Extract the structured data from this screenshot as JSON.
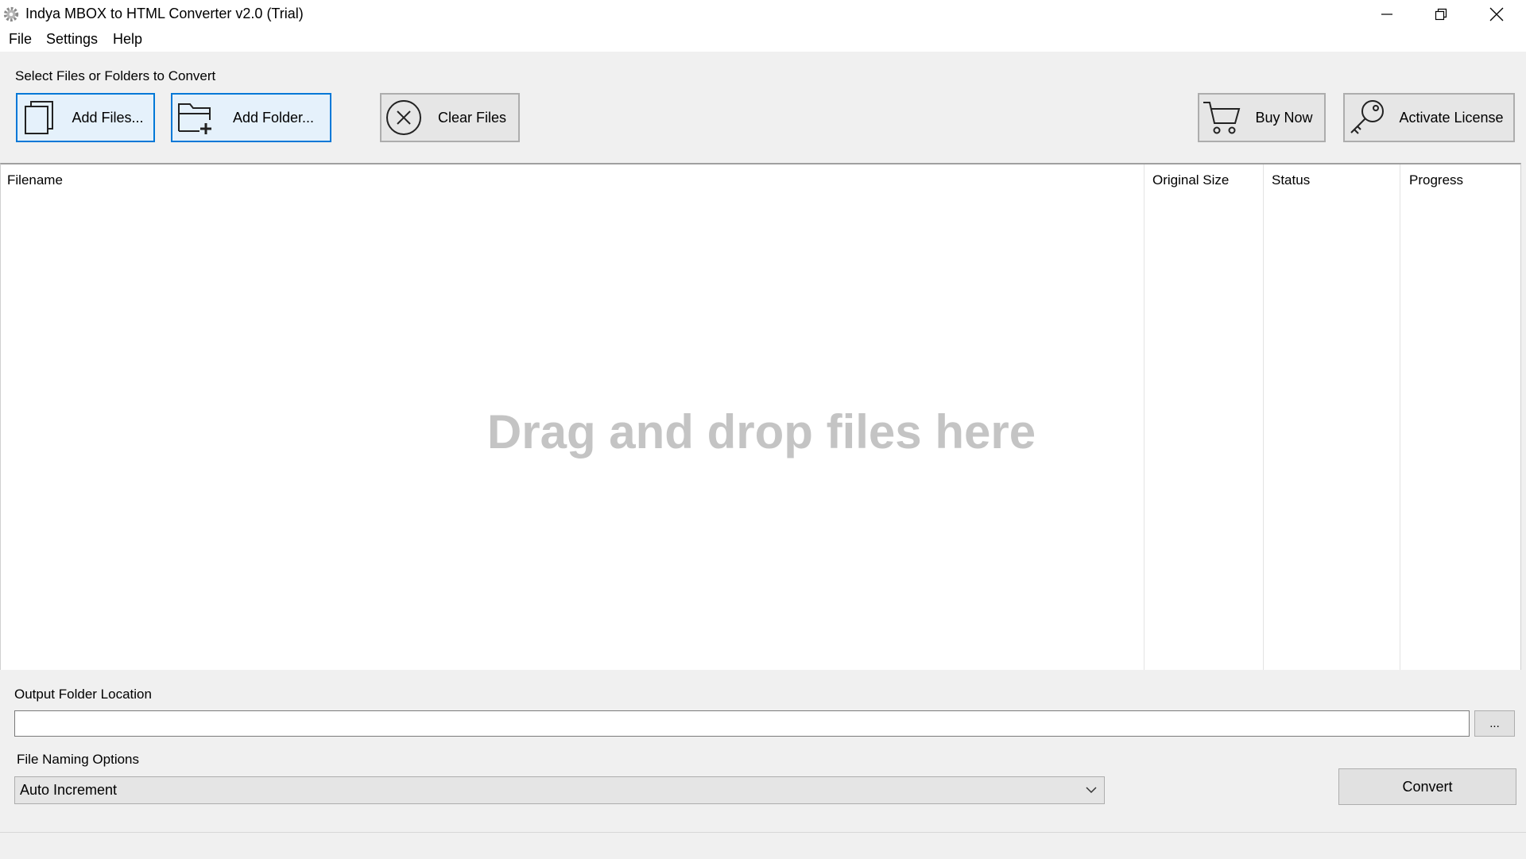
{
  "window": {
    "title": "Indya MBOX to HTML Converter v2.0 (Trial)",
    "icon": "gear-icon"
  },
  "menu": {
    "items": [
      "File",
      "Settings",
      "Help"
    ]
  },
  "source": {
    "label": "Select Files or Folders to Convert",
    "add_files": "Add Files...",
    "add_folder": "Add Folder...",
    "clear_files": "Clear Files",
    "buy_now": "Buy Now",
    "activate_license": "Activate License"
  },
  "file_list": {
    "columns": [
      "Filename",
      "Original Size",
      "Status",
      "Progress"
    ],
    "rows": [],
    "empty_hint": "Drag and drop files here"
  },
  "output": {
    "label": "Output Folder Location",
    "path": "",
    "browse_label": "..."
  },
  "naming": {
    "label": "File Naming Options",
    "selected": "Auto Increment"
  },
  "convert_label": "Convert",
  "colors": {
    "accent_border": "#0078d7",
    "drop_hint": "#c4c4c4"
  }
}
